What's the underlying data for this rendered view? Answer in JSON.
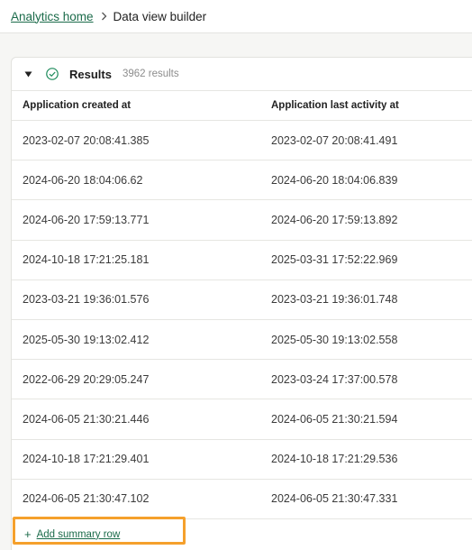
{
  "breadcrumb": {
    "home_label": "Analytics home",
    "current_label": "Data view builder"
  },
  "results": {
    "title": "Results",
    "count": "3962 results"
  },
  "table": {
    "columns": [
      "Application created at",
      "Application last activity at"
    ],
    "rows": [
      [
        "2023-02-07 20:08:41.385",
        "2023-02-07 20:08:41.491"
      ],
      [
        "2024-06-20 18:04:06.62",
        "2024-06-20 18:04:06.839"
      ],
      [
        "2024-06-20 17:59:13.771",
        "2024-06-20 17:59:13.892"
      ],
      [
        "2024-10-18 17:21:25.181",
        "2025-03-31 17:52:22.969"
      ],
      [
        "2023-03-21 19:36:01.576",
        "2023-03-21 19:36:01.748"
      ],
      [
        "2025-05-30 19:13:02.412",
        "2025-05-30 19:13:02.558"
      ],
      [
        "2022-06-29 20:29:05.247",
        "2023-03-24 17:37:00.578"
      ],
      [
        "2024-06-05 21:30:21.446",
        "2024-06-05 21:30:21.594"
      ],
      [
        "2024-10-18 17:21:29.401",
        "2024-10-18 17:21:29.536"
      ],
      [
        "2024-06-05 21:30:47.102",
        "2024-06-05 21:30:47.331"
      ]
    ]
  },
  "summary": {
    "plus": "+",
    "label": "Add summary row"
  },
  "colors": {
    "accent": "#1b6b4a",
    "highlight": "#f5a02c"
  }
}
